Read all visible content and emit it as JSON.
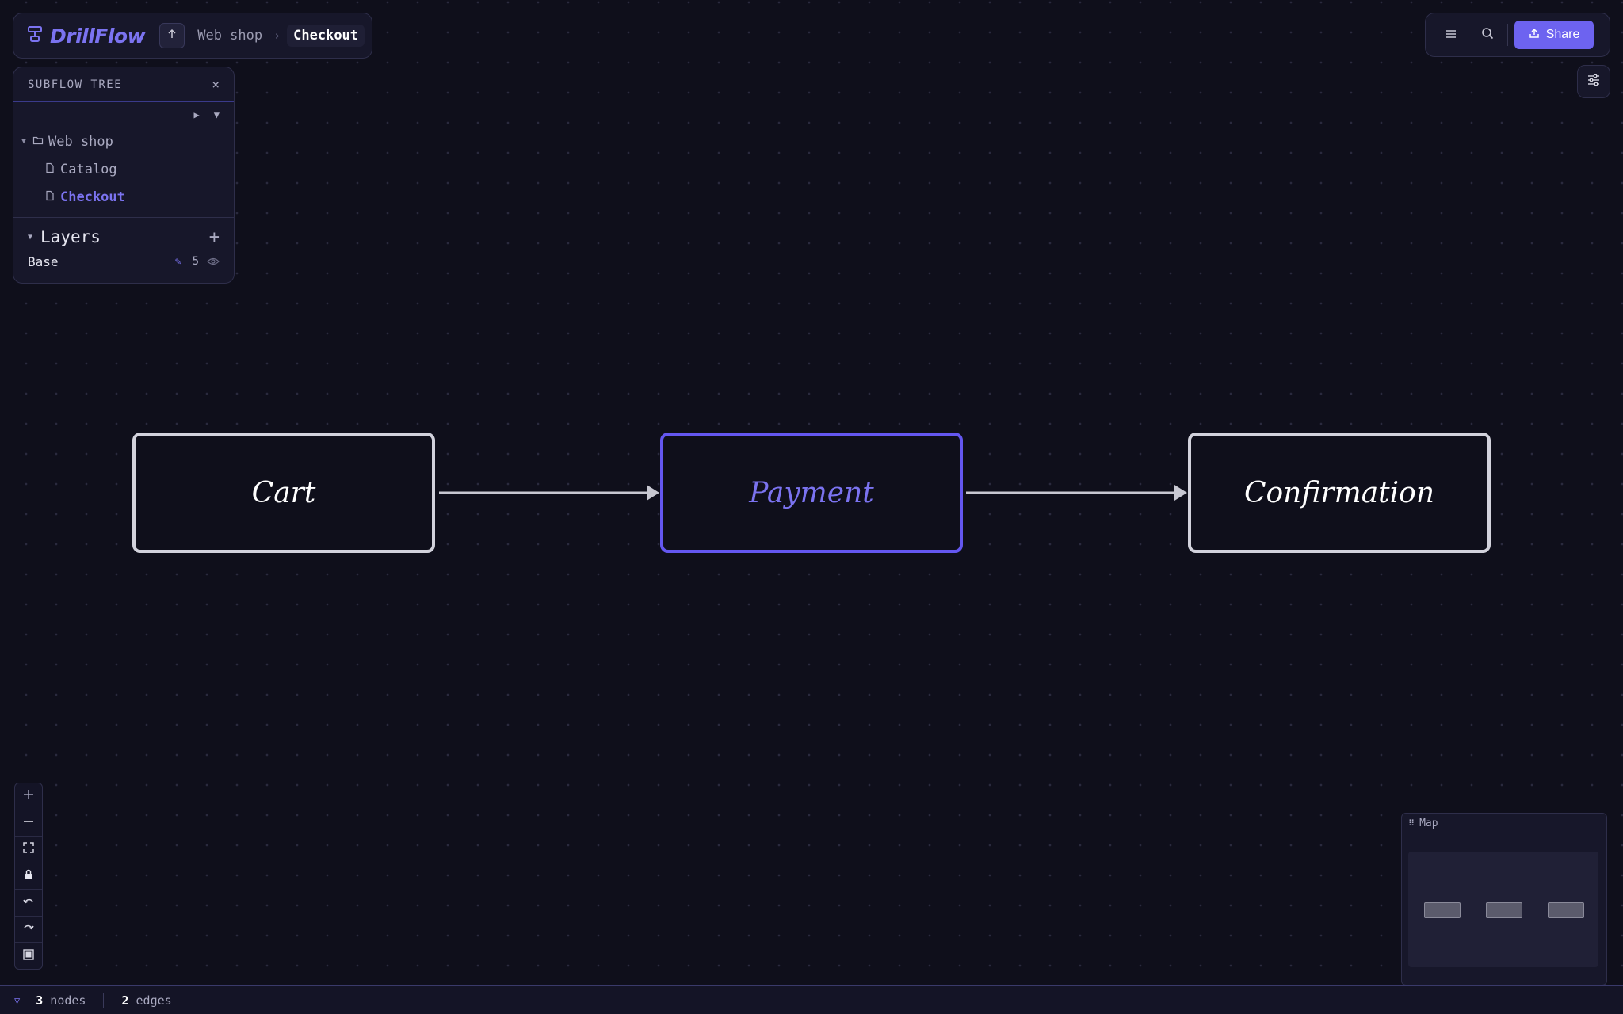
{
  "app": {
    "name": "DrillFlow",
    "accent": "#6d63f0"
  },
  "breadcrumb": {
    "parent": "Web shop",
    "separator": "›",
    "current": "Checkout"
  },
  "toolbar": {
    "menu_icon": "hamburger-icon",
    "search_icon": "search-icon",
    "share_label": "Share"
  },
  "tree": {
    "title": "SUBFLOW TREE",
    "close": "×",
    "expand_label": "▶",
    "collapse_label": "▼",
    "root": "Web shop",
    "children": [
      "Catalog",
      "Checkout"
    ]
  },
  "layers": {
    "title": "Layers",
    "add": "+",
    "items": [
      {
        "name": "Base",
        "count": "5"
      }
    ]
  },
  "nodes": [
    {
      "label": "Cart"
    },
    {
      "label": "Payment",
      "selected": true
    },
    {
      "label": "Confirmation"
    }
  ],
  "minimap": {
    "title": "Map"
  },
  "status": {
    "nodes_count": "3",
    "nodes_label": "nodes",
    "edges_count": "2",
    "edges_label": "edges"
  }
}
